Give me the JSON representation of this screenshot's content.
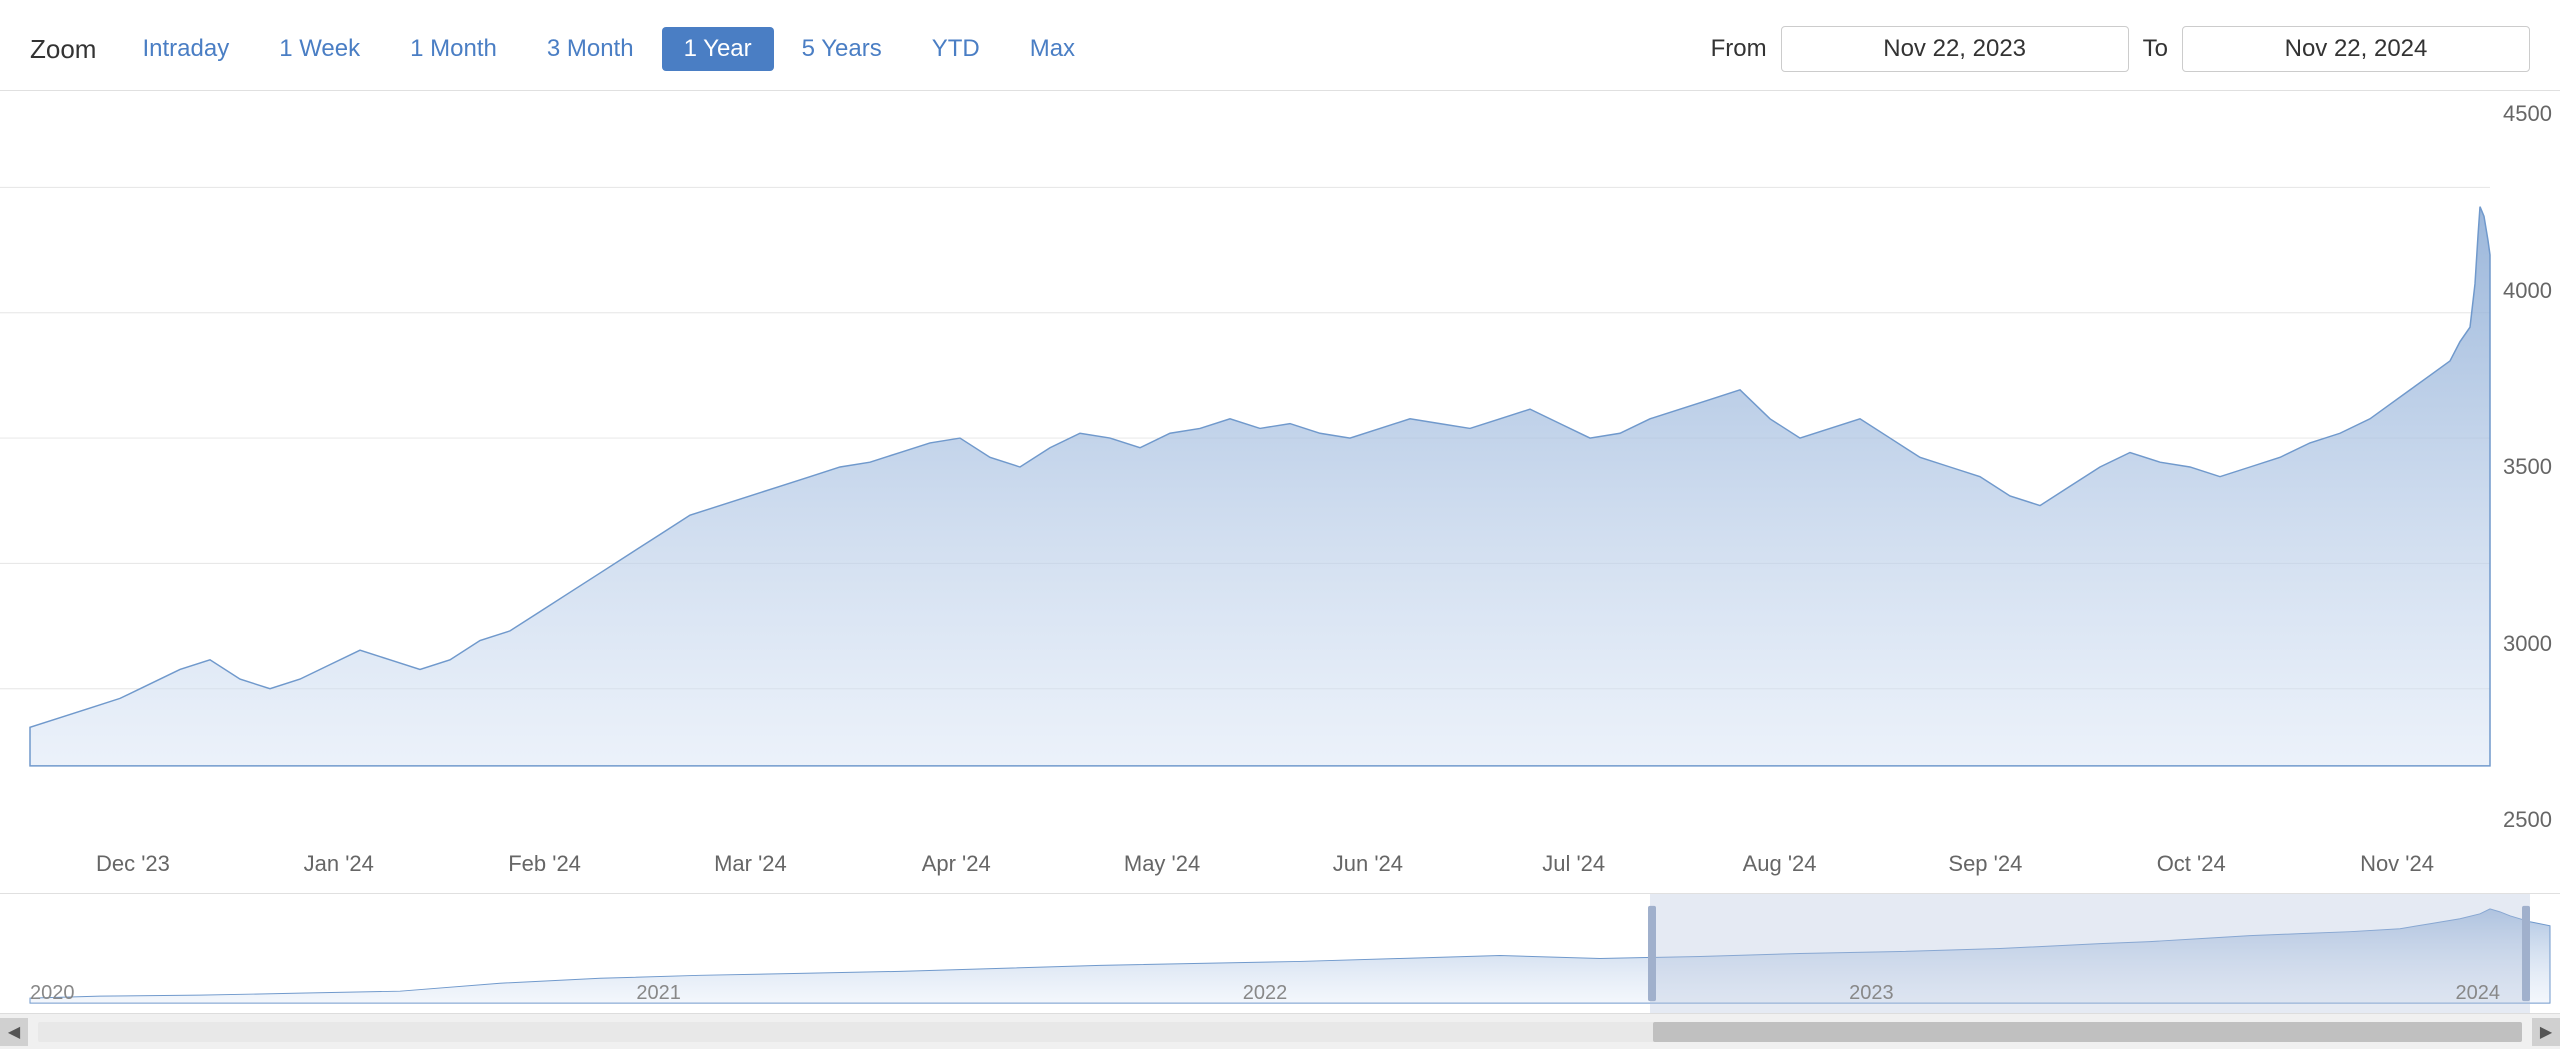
{
  "toolbar": {
    "zoom_label": "Zoom",
    "buttons": [
      {
        "label": "Intraday",
        "active": false
      },
      {
        "label": "1 Week",
        "active": false
      },
      {
        "label": "1 Month",
        "active": false
      },
      {
        "label": "3 Month",
        "active": false
      },
      {
        "label": "1 Year",
        "active": true
      },
      {
        "label": "5 Years",
        "active": false
      },
      {
        "label": "YTD",
        "active": false
      },
      {
        "label": "Max",
        "active": false
      }
    ],
    "from_label": "From",
    "to_label": "To",
    "from_date": "Nov 22, 2023",
    "to_date": "Nov 22, 2024"
  },
  "x_axis": {
    "labels": [
      "Dec '23",
      "Jan '24",
      "Feb '24",
      "Mar '24",
      "Apr '24",
      "May '24",
      "Jun '24",
      "Jul '24",
      "Aug '24",
      "Sep '24",
      "Oct '24",
      "Nov '24"
    ]
  },
  "y_axis": {
    "labels": [
      "4500",
      "4000",
      "3500",
      "3000",
      "2500"
    ]
  },
  "mini_chart": {
    "year_labels": [
      "2020",
      "2021",
      "2022",
      "2023",
      "2024"
    ]
  },
  "colors": {
    "accent": "#4a7ec4",
    "chart_fill_top": "#8aaad4",
    "chart_fill_bottom": "#d0dcf0",
    "active_btn_bg": "#4a7ec4",
    "active_btn_text": "#ffffff"
  }
}
